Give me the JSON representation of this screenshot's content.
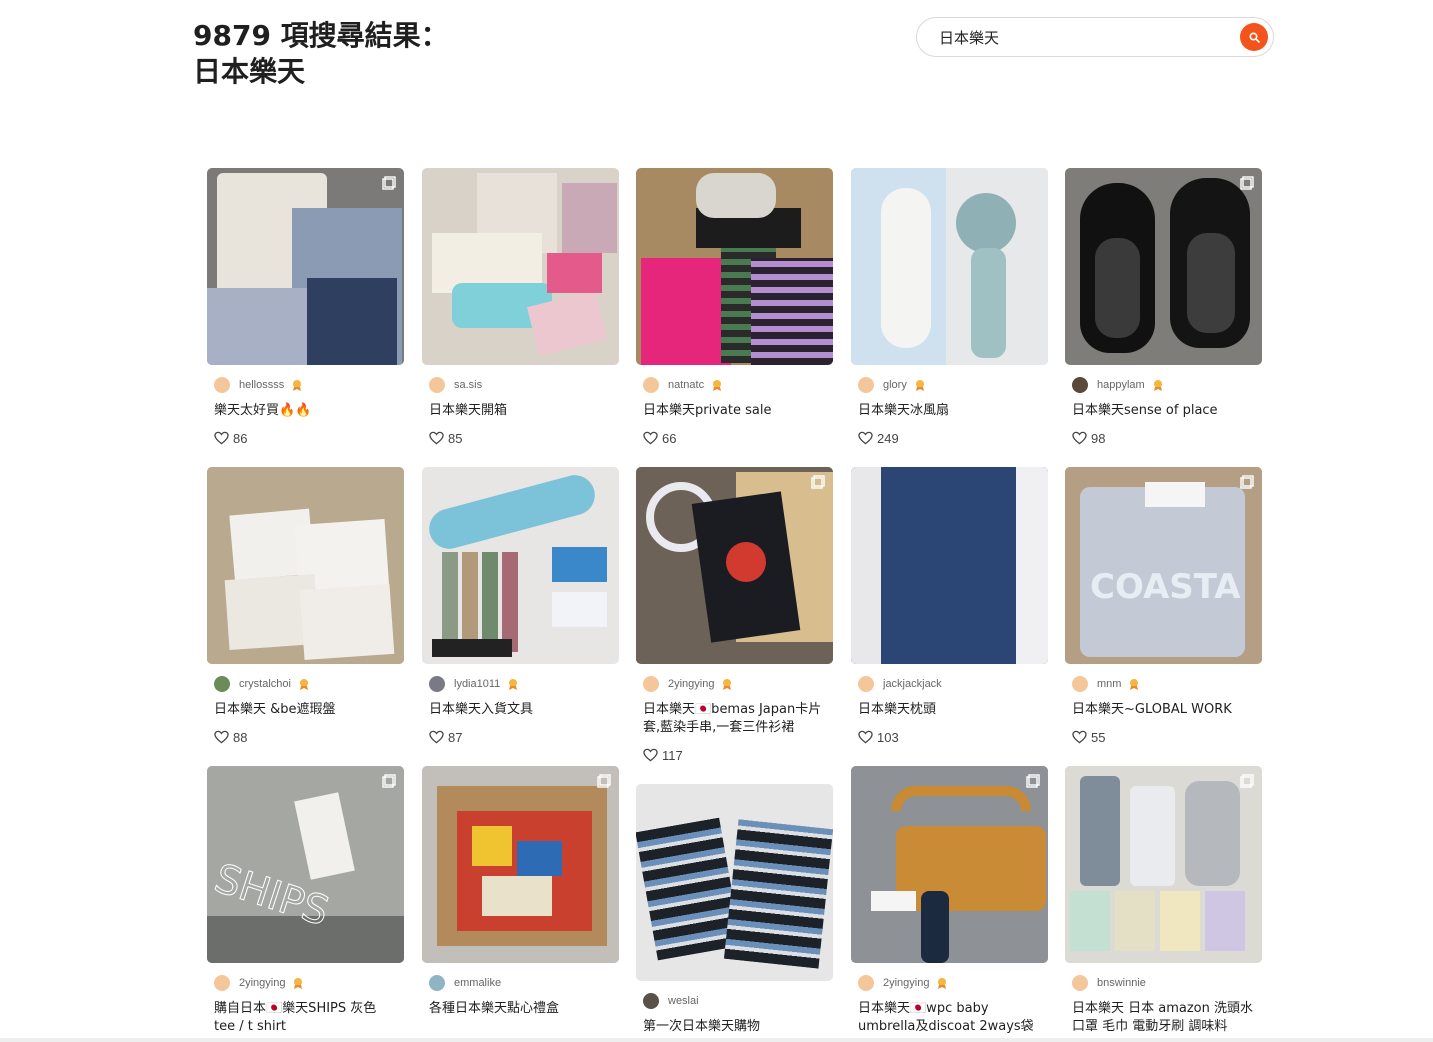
{
  "header": {
    "result_count": "9879 項搜尋結果：",
    "query": "日本樂天"
  },
  "search": {
    "value": "日本樂天",
    "button_icon": "search-icon",
    "accent": "#f2541b"
  },
  "posts": [
    {
      "author": "hellossss",
      "title": "樂天太好買🔥🔥",
      "likes": "86"
    },
    {
      "author": "sa.sis",
      "title": "日本樂天開箱",
      "likes": "85"
    },
    {
      "author": "natnatc",
      "title": "日本樂天private sale",
      "likes": "66"
    },
    {
      "author": "glory",
      "title": "日本樂天冰風扇",
      "likes": "249"
    },
    {
      "author": "happylam",
      "title": "日本樂天sense of place",
      "likes": "98"
    },
    {
      "author": "crystalchoi",
      "title": "日本樂天 &be遮瑕盤",
      "likes": "88"
    },
    {
      "author": "lydia1011",
      "title": "日本樂天入貨文具",
      "likes": "87"
    },
    {
      "author": "2yingying",
      "title": "日本樂天🇯🇵bemas Japan卡片套,藍染手串,一套三件衫裙",
      "likes": "117"
    },
    {
      "author": "jackjackjack",
      "title": "日本樂天枕頭",
      "likes": "103"
    },
    {
      "author": "mnm",
      "title": "日本樂天~GLOBAL WORK",
      "likes": "55"
    },
    {
      "author": "2yingying",
      "title": "購自日本🇯🇵樂天SHIPS 灰色tee / t shirt",
      "likes": ""
    },
    {
      "author": "emmalike",
      "title": "各種日本樂天點心禮盒",
      "likes": ""
    },
    {
      "author": "weslai",
      "title": "第一次日本樂天購物",
      "likes": ""
    },
    {
      "author": "2yingying",
      "title": "日本樂天🇯🇵wpc baby umbrella及discoat 2ways袋",
      "likes": ""
    },
    {
      "author": "bnswinnie",
      "title": "日本樂天 日本 amazon 洗頭水 口罩 毛巾 電動牙刷 調味料",
      "likes": ""
    }
  ]
}
